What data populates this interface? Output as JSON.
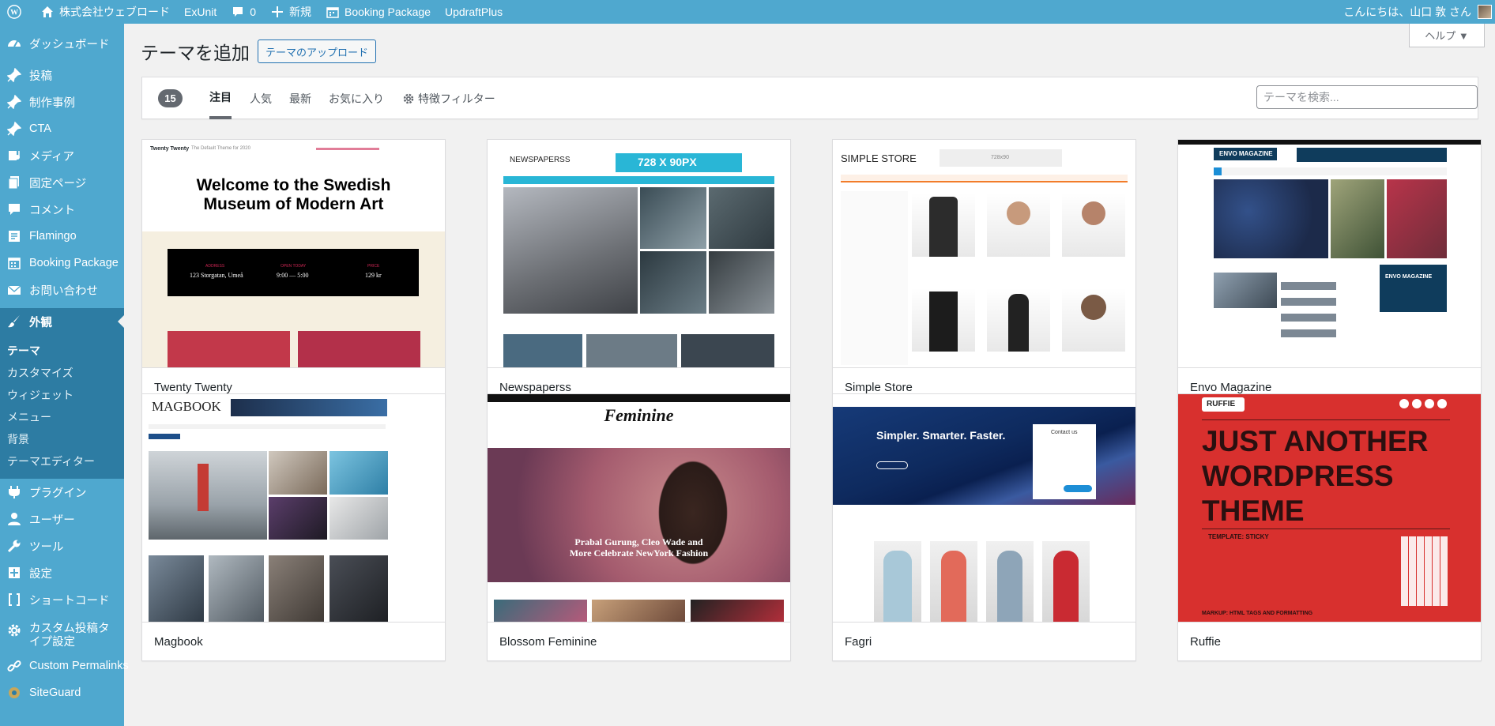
{
  "admin_bar": {
    "site_name": "株式会社ウェブロード",
    "plugin_link": "ExUnit",
    "comments_count": "0",
    "new_label": "新規",
    "booking_label": "Booking Package",
    "updraft_label": "UpdraftPlus",
    "greeting": "こんにちは、山口 敦 さん"
  },
  "sidebar": {
    "items": [
      {
        "label": "ダッシュボード",
        "icon": "dashboard-icon"
      },
      {
        "label": "投稿",
        "icon": "pin-icon"
      },
      {
        "label": "制作事例",
        "icon": "pin-icon"
      },
      {
        "label": "CTA",
        "icon": "pin-icon"
      },
      {
        "label": "メディア",
        "icon": "media-icon"
      },
      {
        "label": "固定ページ",
        "icon": "page-icon"
      },
      {
        "label": "コメント",
        "icon": "comment-icon"
      },
      {
        "label": "Flamingo",
        "icon": "flamingo-icon"
      },
      {
        "label": "Booking Package",
        "icon": "calendar-icon"
      },
      {
        "label": "お問い合わせ",
        "icon": "mail-icon"
      },
      {
        "label": "外観",
        "icon": "brush-icon"
      },
      {
        "label": "プラグイン",
        "icon": "plugin-icon"
      },
      {
        "label": "ユーザー",
        "icon": "user-icon"
      },
      {
        "label": "ツール",
        "icon": "wrench-icon"
      },
      {
        "label": "設定",
        "icon": "settings-icon"
      },
      {
        "label": "ショートコード",
        "icon": "brackets-icon"
      },
      {
        "label": "カスタム投稿タイプ設定",
        "icon": "gear-icon"
      },
      {
        "label": "Custom Permalinks",
        "icon": "link-icon"
      },
      {
        "label": "SiteGuard",
        "icon": "shield-icon"
      }
    ],
    "submenu": [
      "テーマ",
      "カスタマイズ",
      "ウィジェット",
      "メニュー",
      "背景",
      "テーマエディター"
    ]
  },
  "page": {
    "title": "テーマを追加",
    "upload_button": "テーマのアップロード",
    "help": "ヘルプ ▼"
  },
  "filters": {
    "count": "15",
    "tabs": [
      "注目",
      "人気",
      "最新",
      "お気に入り",
      "特徴フィルター"
    ],
    "search_placeholder": "テーマを検索..."
  },
  "themes": [
    {
      "name": "Twenty Twenty"
    },
    {
      "name": "Newspaperss"
    },
    {
      "name": "Simple Store"
    },
    {
      "name": "Envo Magazine"
    },
    {
      "name": "Magbook"
    },
    {
      "name": "Blossom Feminine"
    },
    {
      "name": "Fagri"
    },
    {
      "name": "Ruffie"
    }
  ],
  "previews": {
    "tt_brand": "Twenty Twenty",
    "tt_tagline": "The Default Theme for 2020",
    "tt_heading": "Welcome to the Swedish Museum of Modern Art",
    "tt_address_label": "ADDRESS",
    "tt_address": "123 Storgatan, Umeå",
    "tt_open_label": "OPEN TODAY",
    "tt_open": "9:00 — 5:00",
    "tt_price_label": "PRICE",
    "tt_price": "129 kr",
    "np_logo": "NEWSPAPERSS",
    "np_ad": "728 X 90PX",
    "ss_logo": "SIMPLE STORE",
    "ss_ad": "728x90",
    "envo_logo": "ENVO MAGAZINE",
    "mb_logo": "MAGBOOK",
    "fem_logo": "Feminine",
    "fem_caption": "Prabal Gurung, Cleo Wade and More Celebrate NewYork Fashion",
    "fagri_heading": "Simpler. Smarter. Faster.",
    "fagri_contact": "Contact us",
    "ruffie_logo": "RUFFIE",
    "ruffie_heading": "JUST ANOTHER WORDPRESS THEME",
    "ruffie_sub1": "TEMPLATE: STICKY",
    "ruffie_sub2": "MARKUP: HTML TAGS AND FORMATTING"
  },
  "colors": {
    "admin_bar": "#4fa8cf",
    "sidebar": "#4fa8cf",
    "sidebar_current": "#2d7ca3",
    "link": "#2271b1"
  }
}
